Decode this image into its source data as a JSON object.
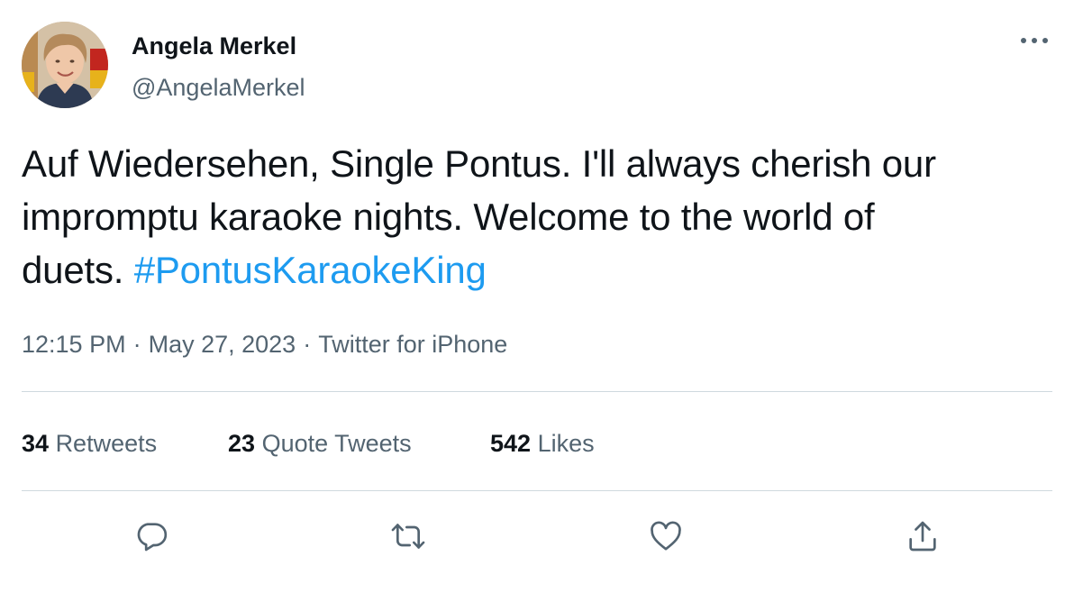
{
  "author": {
    "display_name": "Angela Merkel",
    "handle": "@AngelaMerkel"
  },
  "tweet": {
    "text_lines": [
      "Auf Wiedersehen, Single Pontus. I'll always cherish our",
      "impromptu karaoke nights. Welcome to the world of",
      "duets. "
    ],
    "hashtag": "#PontusKaraokeKing",
    "time": "12:15 PM",
    "separator": "·",
    "date": "May 27, 2023",
    "source": "Twitter for iPhone"
  },
  "stats": {
    "retweets": {
      "count": "34",
      "label": "Retweets"
    },
    "quote_tweets": {
      "count": "23",
      "label": "Quote Tweets"
    },
    "likes": {
      "count": "542",
      "label": "Likes"
    }
  },
  "icons": {
    "more": "more-icon",
    "reply": "reply-icon",
    "retweet": "retweet-icon",
    "like": "heart-icon",
    "share": "share-icon"
  },
  "colors": {
    "text": "#0f1419",
    "secondary": "#536471",
    "link": "#1d9bf0",
    "divider": "#cfd9de"
  }
}
